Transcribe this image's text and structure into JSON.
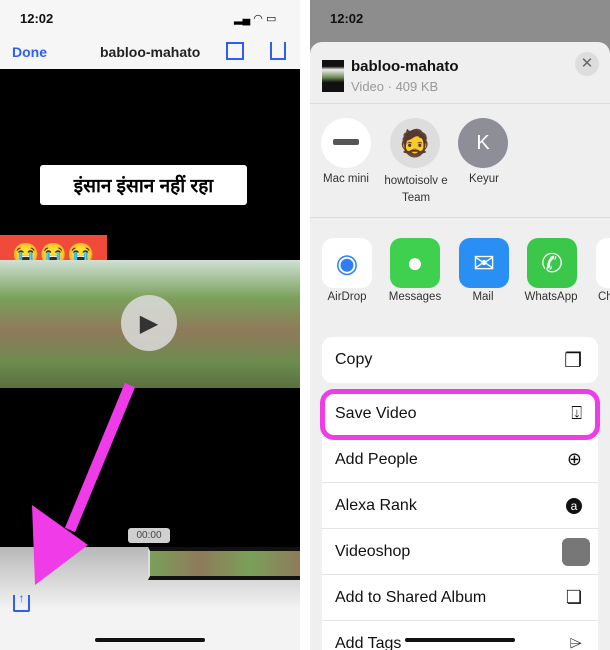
{
  "left": {
    "time": "12:02",
    "done": "Done",
    "title": "babloo-mahato",
    "caption": "इंसान इंसान नहीं रहा",
    "emoji": "😭😭😭",
    "timecode": "00:00"
  },
  "right": {
    "time": "12:02",
    "file_name": "babloo-mahato",
    "file_meta": "Video · 409 KB",
    "people": [
      {
        "name": "Mac mini"
      },
      {
        "name": "howtoisolv e Team"
      },
      {
        "name": "Keyur",
        "initial": "K"
      }
    ],
    "apps": [
      {
        "name": "AirDrop"
      },
      {
        "name": "Messages"
      },
      {
        "name": "Mail"
      },
      {
        "name": "WhatsApp"
      },
      {
        "name": "Ch"
      }
    ],
    "actions": [
      {
        "label": "Copy",
        "icon": "copy-icon"
      },
      {
        "label": "Save Video",
        "icon": "save-icon"
      },
      {
        "label": "Add People",
        "icon": "add-people-icon"
      },
      {
        "label": "Alexa Rank",
        "icon": "alexa-icon"
      },
      {
        "label": "Videoshop",
        "icon": "videoshop-icon"
      },
      {
        "label": "Add to Shared Album",
        "icon": "shared-album-icon"
      },
      {
        "label": "Add Tags",
        "icon": "tag-icon"
      }
    ]
  },
  "colors": {
    "accent": "#2f5ef5",
    "highlight": "#f03be8"
  }
}
